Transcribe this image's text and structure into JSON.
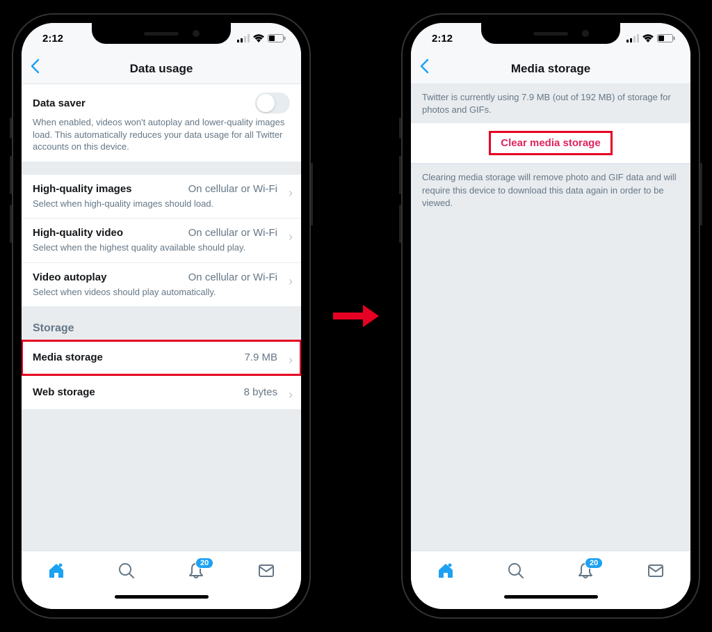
{
  "status": {
    "time": "2:12"
  },
  "left": {
    "nav_title": "Data usage",
    "data_saver": {
      "title": "Data saver",
      "desc": "When enabled, videos won't autoplay and lower-quality images load. This automatically reduces your data usage for all Twitter accounts on this device."
    },
    "hq_images": {
      "title": "High-quality images",
      "value": "On cellular or Wi-Fi",
      "desc": "Select when high-quality images should load."
    },
    "hq_video": {
      "title": "High-quality video",
      "value": "On cellular or Wi-Fi",
      "desc": "Select when the highest quality available should play."
    },
    "autoplay": {
      "title": "Video autoplay",
      "value": "On cellular or Wi-Fi",
      "desc": "Select when videos should play automatically."
    },
    "storage_header": "Storage",
    "media_storage": {
      "title": "Media storage",
      "value": "7.9 MB"
    },
    "web_storage": {
      "title": "Web storage",
      "value": "8 bytes"
    }
  },
  "right": {
    "nav_title": "Media storage",
    "info_top": "Twitter is currently using 7.9 MB (out of 192 MB) of storage for photos and GIFs.",
    "clear_label": "Clear media storage",
    "info_bottom": "Clearing media storage will remove photo and GIF data and will require this device to download this data again in order to be viewed."
  },
  "tabs": {
    "badge": "20"
  }
}
